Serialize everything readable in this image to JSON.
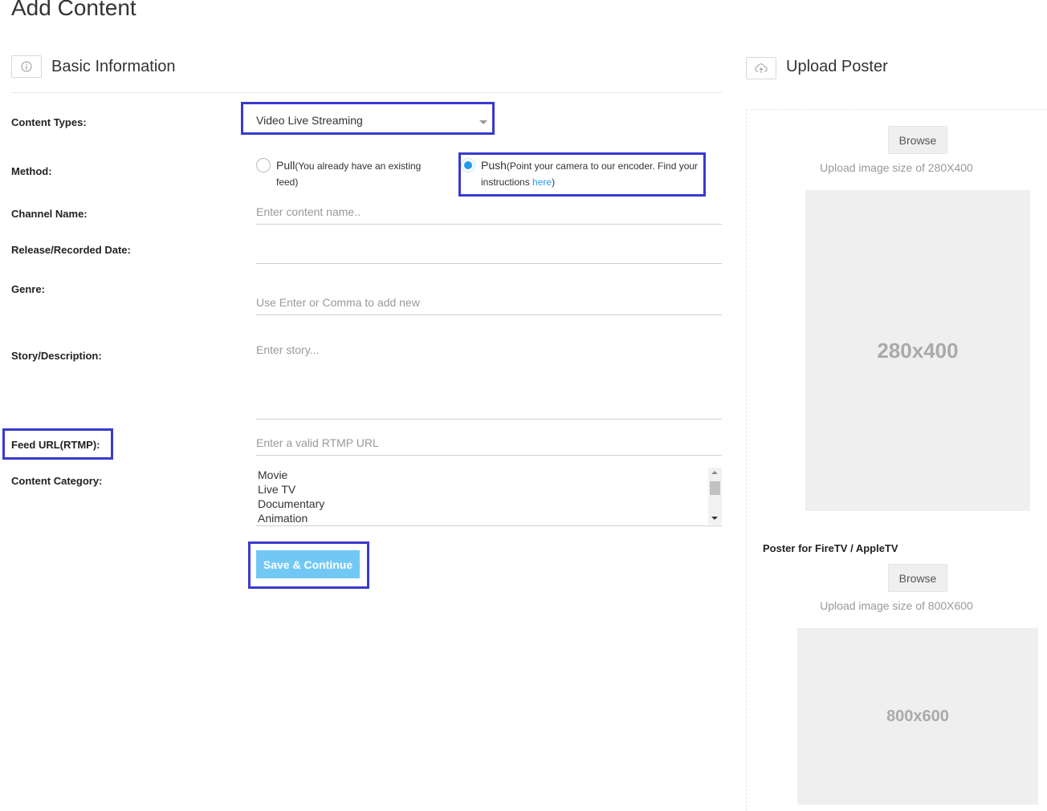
{
  "page": {
    "title": "Add Content"
  },
  "basic": {
    "title": "Basic Information",
    "icon": "info-icon"
  },
  "upload": {
    "title": "Upload Poster",
    "icon": "cloud-upload-icon"
  },
  "form": {
    "content_types": {
      "label": "Content Types:",
      "value": "Video Live Streaming"
    },
    "method": {
      "label": "Method:",
      "pull_main": "Pull",
      "pull_detail_a": "(You already have an existing",
      "pull_detail_b": "feed)",
      "push_main": "Push",
      "push_detail_a": "(Point your camera to our encoder. Find your",
      "push_detail_b": "instructions ",
      "push_link": "here",
      "push_close": ")",
      "selected": "Push"
    },
    "channel_name": {
      "label": "Channel Name:",
      "placeholder": "Enter content name.."
    },
    "release_date": {
      "label": "Release/Recorded Date:"
    },
    "genre": {
      "label": "Genre:",
      "placeholder": "Use Enter or Comma to add new"
    },
    "story": {
      "label": "Story/Description:",
      "placeholder": "Enter story..."
    },
    "feed_url": {
      "label": "Feed URL(RTMP):",
      "placeholder": "Enter a valid RTMP URL"
    },
    "category": {
      "label": "Content Category:",
      "options": [
        "Movie",
        "Live TV",
        "Documentary",
        "Animation"
      ]
    },
    "save_label": "Save & Continue"
  },
  "poster": {
    "browse_label": "Browse",
    "hint": "Upload image size of 280X400",
    "placeholder_text": "280x400"
  },
  "poster_tv": {
    "title": "Poster for FireTV / AppleTV",
    "browse_label": "Browse",
    "hint": "Upload image size of 800X600",
    "placeholder_text": "800x600"
  },
  "colors": {
    "highlight": "#3a3ad0",
    "accent": "#1e9bf0",
    "save_button": "#72c8f5"
  }
}
